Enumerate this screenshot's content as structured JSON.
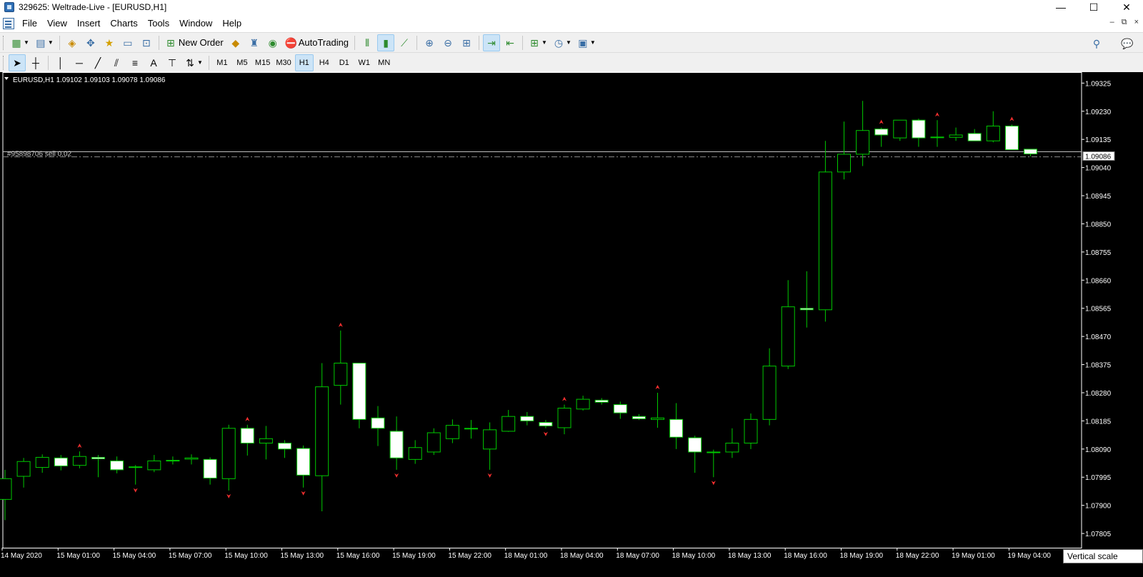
{
  "window": {
    "title": "329625: Weltrade-Live - [EURUSD,H1]",
    "controls": {
      "minimize": "—",
      "maximize": "☐",
      "close": "✕"
    }
  },
  "menu": {
    "items": [
      "File",
      "View",
      "Insert",
      "Charts",
      "Tools",
      "Window",
      "Help"
    ],
    "mdi_controls": {
      "minimize": "–",
      "restore": "⧉",
      "close": "×"
    }
  },
  "toolbar": {
    "new_order_label": "New Order",
    "autotrading_label": "AutoTrading",
    "timeframes": [
      "M1",
      "M5",
      "M15",
      "M30",
      "H1",
      "H4",
      "D1",
      "W1",
      "MN"
    ],
    "active_timeframe": "H1",
    "text_tool_label": "A"
  },
  "chart": {
    "info": "EURUSD,H1  1.09102 1.09103 1.09078 1.09086",
    "order_label": "#95898706 sell 0.02",
    "current_price": "1.09086",
    "tooltip": "Vertical scale",
    "colors": {
      "background": "#000000",
      "bull_fill": "#000000",
      "bear_fill": "#ffffff",
      "candle_outline": "#00c800",
      "wick": "#00c800",
      "axis_text": "#ffffff",
      "fractal_arrow": "#ff3030",
      "order_line": "#8a8a8a",
      "bid_line": "#c0c0c0"
    }
  },
  "chart_data": {
    "type": "candlestick",
    "symbol": "EURUSD",
    "timeframe": "H1",
    "ylim": [
      1.07757,
      1.09362
    ],
    "yticks": [
      "1.09325",
      "1.09230",
      "1.09135",
      "1.09040",
      "1.08945",
      "1.08850",
      "1.08755",
      "1.08660",
      "1.08565",
      "1.08470",
      "1.08375",
      "1.08280",
      "1.08185",
      "1.08090",
      "1.07995",
      "1.07900",
      "1.07805"
    ],
    "xticks": [
      {
        "label": "14 May 2020",
        "index": 0
      },
      {
        "label": "15 May 01:00",
        "index": 3
      },
      {
        "label": "15 May 04:00",
        "index": 6
      },
      {
        "label": "15 May 07:00",
        "index": 9
      },
      {
        "label": "15 May 10:00",
        "index": 12
      },
      {
        "label": "15 May 13:00",
        "index": 15
      },
      {
        "label": "15 May 16:00",
        "index": 18
      },
      {
        "label": "15 May 19:00",
        "index": 21
      },
      {
        "label": "15 May 22:00",
        "index": 24
      },
      {
        "label": "18 May 01:00",
        "index": 27
      },
      {
        "label": "18 May 04:00",
        "index": 30
      },
      {
        "label": "18 May 07:00",
        "index": 33
      },
      {
        "label": "18 May 10:00",
        "index": 36
      },
      {
        "label": "18 May 13:00",
        "index": 39
      },
      {
        "label": "18 May 16:00",
        "index": 42
      },
      {
        "label": "18 May 19:00",
        "index": 45
      },
      {
        "label": "18 May 22:00",
        "index": 48
      },
      {
        "label": "19 May 01:00",
        "index": 51
      },
      {
        "label": "19 May 04:00",
        "index": 54
      }
    ],
    "bid": 1.09086,
    "order_price": 1.09076,
    "candles": [
      {
        "o": 1.0792,
        "h": 1.0802,
        "l": 1.0785,
        "c": 1.0799
      },
      {
        "o": 1.07998,
        "h": 1.0806,
        "l": 1.0796,
        "c": 1.08048
      },
      {
        "o": 1.08028,
        "h": 1.08072,
        "l": 1.0801,
        "c": 1.08062
      },
      {
        "o": 1.0806,
        "h": 1.0807,
        "l": 1.08018,
        "c": 1.08033
      },
      {
        "o": 1.08035,
        "h": 1.08082,
        "l": 1.08025,
        "c": 1.08065
      },
      {
        "o": 1.08062,
        "h": 1.0807,
        "l": 1.07995,
        "c": 1.08057
      },
      {
        "o": 1.0805,
        "h": 1.08065,
        "l": 1.08008,
        "c": 1.0802
      },
      {
        "o": 1.08028,
        "h": 1.08036,
        "l": 1.0797,
        "c": 1.0803
      },
      {
        "o": 1.0802,
        "h": 1.0807,
        "l": 1.08012,
        "c": 1.0805
      },
      {
        "o": 1.0805,
        "h": 1.08065,
        "l": 1.08038,
        "c": 1.08052
      },
      {
        "o": 1.08056,
        "h": 1.08072,
        "l": 1.08038,
        "c": 1.0806
      },
      {
        "o": 1.08055,
        "h": 1.08062,
        "l": 1.0797,
        "c": 1.07992
      },
      {
        "o": 1.0799,
        "h": 1.08172,
        "l": 1.0795,
        "c": 1.0816
      },
      {
        "o": 1.0816,
        "h": 1.08172,
        "l": 1.08068,
        "c": 1.0811
      },
      {
        "o": 1.0811,
        "h": 1.08168,
        "l": 1.08055,
        "c": 1.08125
      },
      {
        "o": 1.0811,
        "h": 1.0812,
        "l": 1.0806,
        "c": 1.0809
      },
      {
        "o": 1.08092,
        "h": 1.08102,
        "l": 1.0796,
        "c": 1.08002
      },
      {
        "o": 1.08,
        "h": 1.0838,
        "l": 1.0788,
        "c": 1.083
      },
      {
        "o": 1.08305,
        "h": 1.0849,
        "l": 1.0824,
        "c": 1.0838
      },
      {
        "o": 1.0838,
        "h": 1.0838,
        "l": 1.0816,
        "c": 1.0819
      },
      {
        "o": 1.08195,
        "h": 1.08235,
        "l": 1.081,
        "c": 1.0816
      },
      {
        "o": 1.0815,
        "h": 1.082,
        "l": 1.0802,
        "c": 1.0806
      },
      {
        "o": 1.08055,
        "h": 1.0812,
        "l": 1.0804,
        "c": 1.08095
      },
      {
        "o": 1.0808,
        "h": 1.0816,
        "l": 1.0807,
        "c": 1.08145
      },
      {
        "o": 1.08125,
        "h": 1.0819,
        "l": 1.0811,
        "c": 1.0817
      },
      {
        "o": 1.0816,
        "h": 1.08188,
        "l": 1.08125,
        "c": 1.0816
      },
      {
        "o": 1.0809,
        "h": 1.0818,
        "l": 1.0802,
        "c": 1.08155
      },
      {
        "o": 1.0815,
        "h": 1.08222,
        "l": 1.08148,
        "c": 1.082
      },
      {
        "o": 1.082,
        "h": 1.08215,
        "l": 1.0817,
        "c": 1.08185
      },
      {
        "o": 1.0818,
        "h": 1.08188,
        "l": 1.0816,
        "c": 1.08168
      },
      {
        "o": 1.08162,
        "h": 1.0824,
        "l": 1.0814,
        "c": 1.08228
      },
      {
        "o": 1.08225,
        "h": 1.0827,
        "l": 1.0822,
        "c": 1.08258
      },
      {
        "o": 1.08255,
        "h": 1.08262,
        "l": 1.0824,
        "c": 1.08248
      },
      {
        "o": 1.0824,
        "h": 1.0825,
        "l": 1.08192,
        "c": 1.08212
      },
      {
        "o": 1.082,
        "h": 1.08208,
        "l": 1.08188,
        "c": 1.08192
      },
      {
        "o": 1.0819,
        "h": 1.0828,
        "l": 1.08162,
        "c": 1.08195
      },
      {
        "o": 1.0819,
        "h": 1.08245,
        "l": 1.0809,
        "c": 1.0813
      },
      {
        "o": 1.08128,
        "h": 1.08135,
        "l": 1.0801,
        "c": 1.0808
      },
      {
        "o": 1.0808,
        "h": 1.08088,
        "l": 1.07995,
        "c": 1.08078
      },
      {
        "o": 1.0808,
        "h": 1.0816,
        "l": 1.0806,
        "c": 1.0811
      },
      {
        "o": 1.0811,
        "h": 1.0821,
        "l": 1.0809,
        "c": 1.0819
      },
      {
        "o": 1.0819,
        "h": 1.0843,
        "l": 1.0817,
        "c": 1.0837
      },
      {
        "o": 1.0837,
        "h": 1.0866,
        "l": 1.0836,
        "c": 1.0857
      },
      {
        "o": 1.08565,
        "h": 1.0869,
        "l": 1.085,
        "c": 1.0856
      },
      {
        "o": 1.0856,
        "h": 1.0913,
        "l": 1.0852,
        "c": 1.09025
      },
      {
        "o": 1.09025,
        "h": 1.09195,
        "l": 1.09,
        "c": 1.09085
      },
      {
        "o": 1.09085,
        "h": 1.09265,
        "l": 1.09045,
        "c": 1.09165
      },
      {
        "o": 1.0917,
        "h": 1.09175,
        "l": 1.0911,
        "c": 1.0915
      },
      {
        "o": 1.0914,
        "h": 1.092,
        "l": 1.0913,
        "c": 1.092
      },
      {
        "o": 1.092,
        "h": 1.09205,
        "l": 1.0911,
        "c": 1.0914
      },
      {
        "o": 1.09143,
        "h": 1.092,
        "l": 1.0911,
        "c": 1.09143
      },
      {
        "o": 1.09142,
        "h": 1.09175,
        "l": 1.0913,
        "c": 1.0915
      },
      {
        "o": 1.09155,
        "h": 1.0917,
        "l": 1.0913,
        "c": 1.0913
      },
      {
        "o": 1.0913,
        "h": 1.0923,
        "l": 1.09125,
        "c": 1.0918
      },
      {
        "o": 1.0918,
        "h": 1.09185,
        "l": 1.091,
        "c": 1.091
      },
      {
        "o": 1.09102,
        "h": 1.09103,
        "l": 1.09078,
        "c": 1.09086
      }
    ],
    "fractals_up": [
      4,
      13,
      18,
      30,
      35,
      47,
      50,
      54
    ],
    "fractals_down": [
      7,
      12,
      16,
      21,
      26,
      29,
      38
    ]
  }
}
